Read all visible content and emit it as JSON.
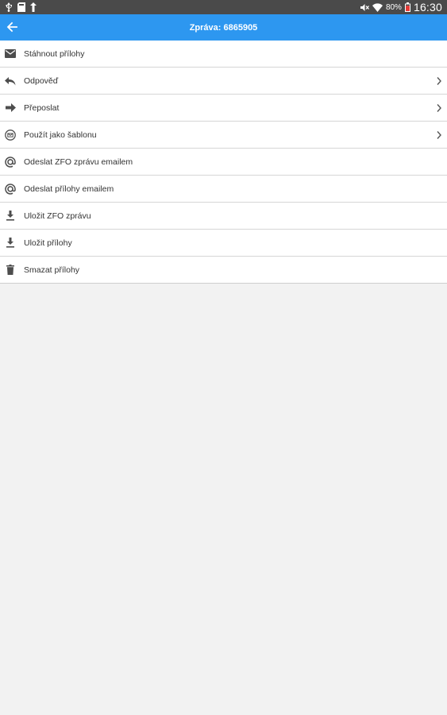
{
  "status_bar": {
    "battery_percent": "80%",
    "time": "16:30"
  },
  "app_bar": {
    "title": "Zpráva: 6865905",
    "color": "#2d97f0"
  },
  "menu": {
    "items": [
      {
        "label": "Stáhnout přílohy",
        "icon": "mail-icon",
        "has_submenu": false
      },
      {
        "label": "Odpověď",
        "icon": "reply-icon",
        "has_submenu": true
      },
      {
        "label": "Přeposlat",
        "icon": "forward-icon",
        "has_submenu": true
      },
      {
        "label": "Použít jako šablonu",
        "icon": "template-icon",
        "has_submenu": true
      },
      {
        "label": "Odeslat ZFO zprávu emailem",
        "icon": "at-icon",
        "has_submenu": false
      },
      {
        "label": "Odeslat přílohy emailem",
        "icon": "at-icon",
        "has_submenu": false
      },
      {
        "label": "Uložit ZFO zprávu",
        "icon": "download-icon",
        "has_submenu": false
      },
      {
        "label": "Uložit přílohy",
        "icon": "download-icon",
        "has_submenu": false
      },
      {
        "label": "Smazat přílohy",
        "icon": "trash-icon",
        "has_submenu": false
      }
    ]
  }
}
